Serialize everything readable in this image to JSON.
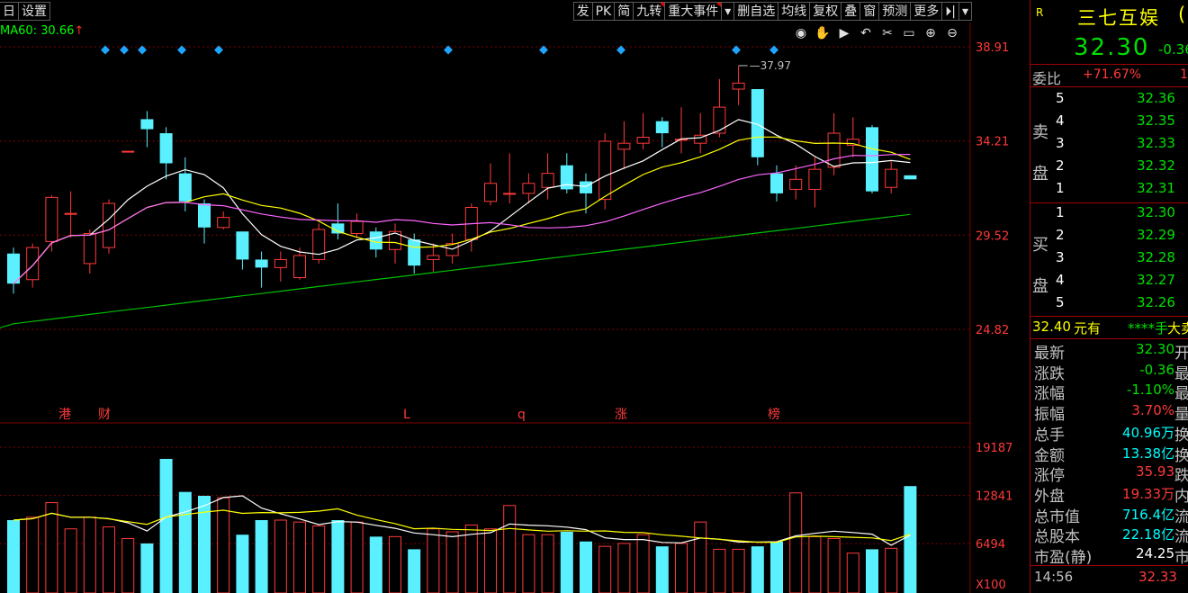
{
  "toolbar": {
    "left": [
      "日",
      "设置"
    ],
    "right": [
      {
        "label": "发",
        "flag": false
      },
      {
        "label": "PK",
        "flag": false
      },
      {
        "label": "简",
        "flag": false
      },
      {
        "label": "九转",
        "flag": true
      },
      {
        "label": "重大事件",
        "flag": true
      },
      {
        "label": "▾",
        "flag": false
      },
      {
        "label": "删自选",
        "flag": false
      },
      {
        "label": "均线",
        "flag": false
      },
      {
        "label": "复权",
        "flag": false
      },
      {
        "label": "叠",
        "flag": false
      },
      {
        "label": "窗",
        "flag": false
      },
      {
        "label": "预测",
        "flag": false
      },
      {
        "label": "更多",
        "flag": false
      },
      {
        "label": "⏵|",
        "flag": false
      },
      {
        "label": "▾",
        "flag": false
      }
    ]
  },
  "ma_legend": {
    "text": "MA60: 30.66",
    "arrow": "↑"
  },
  "price_axis": [
    "38.91",
    "34.21",
    "29.52",
    "24.82"
  ],
  "volume_axis": [
    "19187",
    "12841",
    "6494",
    "X100"
  ],
  "high_marker": "37.97",
  "event_markers": [
    "港",
    "财",
    "L",
    "q",
    "涨",
    "榜"
  ],
  "colors": {
    "up": "#ff3a3a",
    "down": "#5af0ff",
    "ma5": "#ffffff",
    "ma10": "#ffff00",
    "ma20": "#ff66ff",
    "ma60": "#00c000",
    "grid": "#800000"
  },
  "candles": [
    [
      28.6,
      27.1,
      28.9,
      26.6
    ],
    [
      27.3,
      28.9,
      29.1,
      26.9
    ],
    [
      29.2,
      31.4,
      31.5,
      28.7
    ],
    [
      30.6,
      30.6,
      31.7,
      29.4
    ],
    [
      28.1,
      29.6,
      29.8,
      27.6
    ],
    [
      28.9,
      31.1,
      31.3,
      28.6
    ],
    [
      33.7,
      33.7,
      33.7,
      33.7
    ],
    [
      35.3,
      34.8,
      35.7,
      33.9
    ],
    [
      34.6,
      33.1,
      34.9,
      32.3
    ],
    [
      32.6,
      31.2,
      33.4,
      30.7
    ],
    [
      31.1,
      29.9,
      31.3,
      29.1
    ],
    [
      29.9,
      30.4,
      30.7,
      29.8
    ],
    [
      29.7,
      28.3,
      29.7,
      27.8
    ],
    [
      28.3,
      27.9,
      28.7,
      26.9
    ],
    [
      27.9,
      28.3,
      28.7,
      27.2
    ],
    [
      27.4,
      28.5,
      28.9,
      27.3
    ],
    [
      28.3,
      29.8,
      30.1,
      28.1
    ],
    [
      30.1,
      29.6,
      31.1,
      29.3
    ],
    [
      29.6,
      30.2,
      30.6,
      29.4
    ],
    [
      29.7,
      28.8,
      29.9,
      28.4
    ],
    [
      28.8,
      29.7,
      30.1,
      28.1
    ],
    [
      29.3,
      28.0,
      29.6,
      27.6
    ],
    [
      28.3,
      28.5,
      29.1,
      27.7
    ],
    [
      28.5,
      29.1,
      29.6,
      28.1
    ],
    [
      29.3,
      30.9,
      31.1,
      28.7
    ],
    [
      31.2,
      32.1,
      33.1,
      31.0
    ],
    [
      31.6,
      31.6,
      33.6,
      31.1
    ],
    [
      31.6,
      32.1,
      32.6,
      31.1
    ],
    [
      31.9,
      32.6,
      33.6,
      31.3
    ],
    [
      33.0,
      31.8,
      33.6,
      31.6
    ],
    [
      32.2,
      31.6,
      32.6,
      30.6
    ],
    [
      31.3,
      34.2,
      34.6,
      30.8
    ],
    [
      33.8,
      34.1,
      35.2,
      32.8
    ],
    [
      34.1,
      34.4,
      35.6,
      33.8
    ],
    [
      35.2,
      34.6,
      35.4,
      33.9
    ],
    [
      34.3,
      34.3,
      35.9,
      33.6
    ],
    [
      34.1,
      34.5,
      35.6,
      33.6
    ],
    [
      34.6,
      35.9,
      37.3,
      34.4
    ],
    [
      36.8,
      37.1,
      37.97,
      36.0
    ],
    [
      36.8,
      33.4,
      36.8,
      33.0
    ],
    [
      32.6,
      31.6,
      33.0,
      31.2
    ],
    [
      31.8,
      32.3,
      33.0,
      31.3
    ],
    [
      31.8,
      32.8,
      33.4,
      30.9
    ],
    [
      32.9,
      34.6,
      35.6,
      32.5
    ],
    [
      34.0,
      34.3,
      35.4,
      33.4
    ],
    [
      34.9,
      31.7,
      35.0,
      31.6
    ],
    [
      31.9,
      32.8,
      33.2,
      31.6
    ],
    [
      32.5,
      32.3,
      32.5,
      32.3
    ]
  ],
  "volumes": [
    75,
    78,
    93,
    66,
    78,
    68,
    56,
    51,
    138,
    104,
    100,
    98,
    60,
    75,
    75,
    73,
    69,
    75,
    73,
    58,
    58,
    45,
    66,
    63,
    70,
    66,
    90,
    60,
    60,
    63,
    53,
    48,
    51,
    60,
    48,
    51,
    73,
    45,
    45,
    48,
    53,
    103,
    58,
    56,
    41,
    45,
    46,
    110,
    78,
    60,
    66,
    59
  ],
  "right_panel": {
    "badge": "R",
    "name": "三七互娱",
    "name_tail": "(",
    "price": "32.30",
    "change": "-0.36",
    "weibi_label": "委比",
    "weibi_value": "+71.67%",
    "weibi_tail": "1",
    "sell_label": [
      "卖",
      "盘"
    ],
    "buy_label": [
      "买",
      "盘"
    ],
    "asks": [
      {
        "n": "5",
        "p": "32.36"
      },
      {
        "n": "4",
        "p": "32.35"
      },
      {
        "n": "3",
        "p": "32.33"
      },
      {
        "n": "2",
        "p": "32.32"
      },
      {
        "n": "1",
        "p": "32.31"
      }
    ],
    "bids": [
      {
        "n": "1",
        "p": "32.30"
      },
      {
        "n": "2",
        "p": "32.29"
      },
      {
        "n": "3",
        "p": "32.28"
      },
      {
        "n": "4",
        "p": "32.27"
      },
      {
        "n": "5",
        "p": "32.26"
      }
    ],
    "bigorder": {
      "price": "32.40",
      "mid": "元有",
      "qty": "****手",
      "tail": "大卖"
    },
    "stats": [
      {
        "label": "最新",
        "value": "32.30",
        "tail": "开"
      },
      {
        "label": "涨跌",
        "value": "-0.36",
        "tail": "最"
      },
      {
        "label": "涨幅",
        "value": "-1.10%",
        "tail": "最"
      },
      {
        "label": "振幅",
        "value": "3.70%",
        "tail": "量"
      },
      {
        "label": "总手",
        "value": "40.96万",
        "tail": "换"
      },
      {
        "label": "金额",
        "value": "13.38亿",
        "tail": "换"
      },
      {
        "label": "涨停",
        "value": "35.93",
        "tail": "跌"
      },
      {
        "label": "外盘",
        "value": "19.33万",
        "tail": "内"
      },
      {
        "label": "总市值",
        "value": "716.4亿",
        "tail": "流"
      },
      {
        "label": "总股本",
        "value": "22.18亿",
        "tail": "流"
      },
      {
        "label": "市盈(静)",
        "value": "24.25",
        "tail": "市"
      }
    ],
    "tick": {
      "time": "14:56",
      "price": "32.33"
    }
  }
}
